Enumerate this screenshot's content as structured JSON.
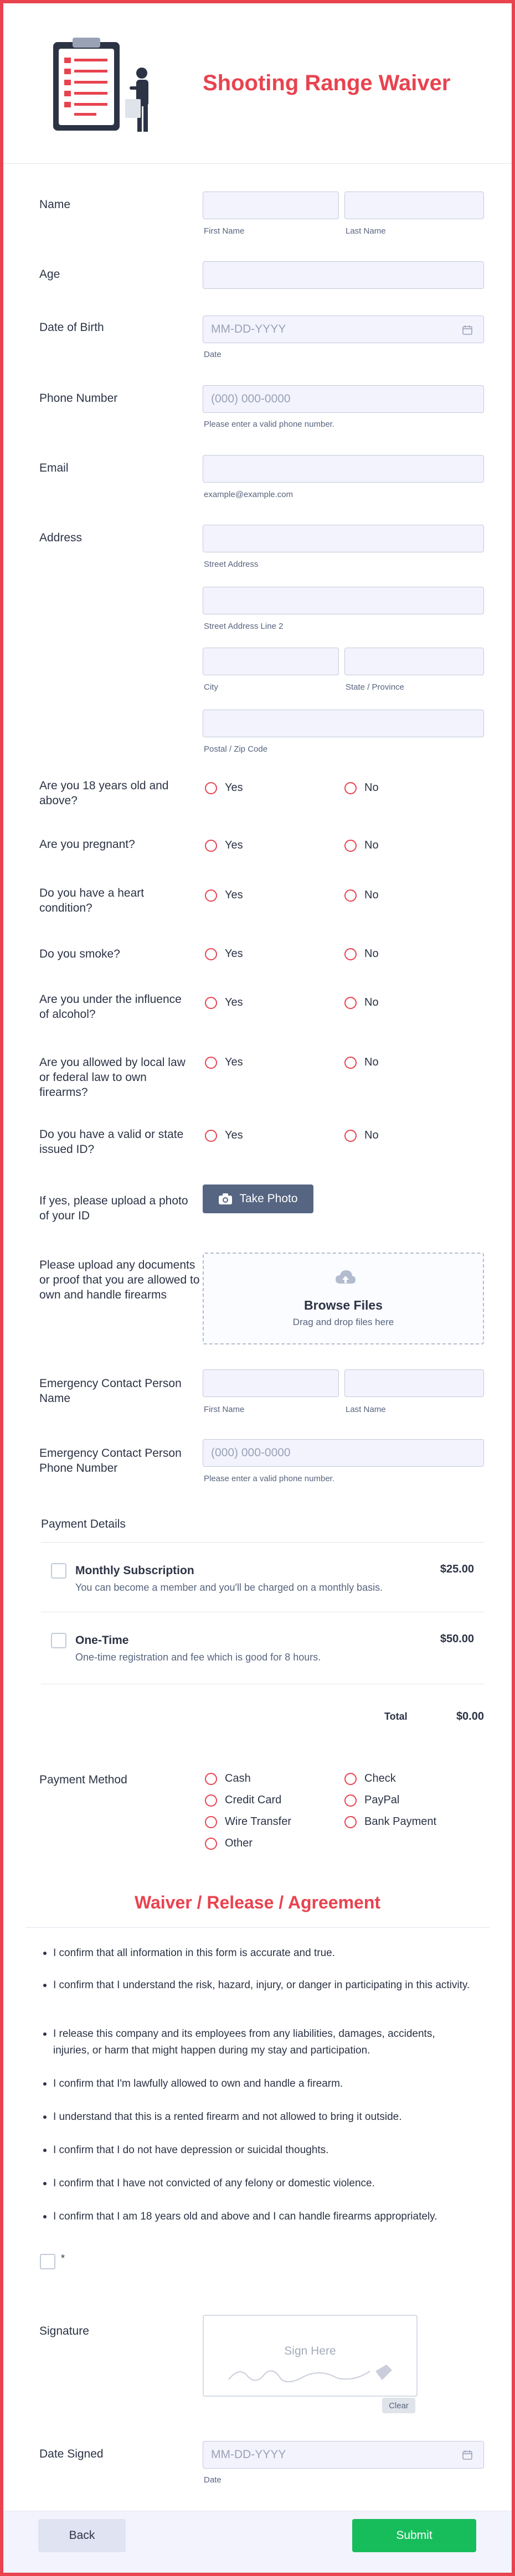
{
  "header": {
    "title": "Shooting Range Waiver"
  },
  "fields": {
    "name": {
      "label": "Name",
      "first_sub": "First Name",
      "last_sub": "Last Name",
      "first_value": "",
      "last_value": ""
    },
    "age": {
      "label": "Age",
      "value": ""
    },
    "dob": {
      "label": "Date of Birth",
      "placeholder": "MM-DD-YYYY",
      "sub": "Date"
    },
    "phone": {
      "label": "Phone Number",
      "placeholder": "(000) 000-0000",
      "sub": "Please enter a valid phone number."
    },
    "email": {
      "label": "Email",
      "sub": "example@example.com"
    },
    "address": {
      "label": "Address",
      "street_sub": "Street Address",
      "street2_sub": "Street Address Line 2",
      "city_sub": "City",
      "state_sub": "State / Province",
      "zip_sub": "Postal / Zip Code"
    }
  },
  "yes_no": {
    "yes": "Yes",
    "no": "No",
    "questions": [
      "Are you 18 years old and above?",
      "Are you pregnant?",
      "Do you have a heart condition?",
      "Do you smoke?",
      "Are you under the influence of alcohol?",
      "Are you allowed by local law or federal law to own firearms?",
      "Do you have a valid or state issued ID?"
    ]
  },
  "photo": {
    "label": "If yes, please upload a photo of your ID",
    "button": "Take Photo"
  },
  "upload": {
    "label": "Please upload any documents or proof that you are allowed to own and handle firearms",
    "title": "Browse Files",
    "hint": "Drag and drop files here"
  },
  "emergency": {
    "name_label": "Emergency Contact Person Name",
    "first_sub": "First Name",
    "last_sub": "Last Name",
    "phone_label": "Emergency Contact Person Phone Number",
    "phone_placeholder": "(000) 000-0000",
    "phone_sub": "Please enter a valid phone number."
  },
  "payment": {
    "label": "Payment Details",
    "products": [
      {
        "name": "Monthly Subscription",
        "desc": "You can become a member and you'll be charged on a monthly basis.",
        "price": "$25.00"
      },
      {
        "name": "One-Time",
        "desc": "One-time registration and fee which is good for 8 hours.",
        "price": "$50.00"
      }
    ],
    "total_label": "Total",
    "total_value": "$0.00"
  },
  "payment_method": {
    "label": "Payment Method",
    "options": [
      "Cash",
      "Check",
      "Credit Card",
      "PayPal",
      "Wire Transfer",
      "Bank Payment",
      "Other"
    ]
  },
  "agreement": {
    "title": "Waiver / Release / Agreement",
    "items": [
      "I confirm that all information in this form is accurate and true.",
      "I confirm that I understand the risk, hazard, injury, or danger in participating in this activity.",
      "I release this company and its employees from any liabilities, damages, accidents, injuries, or harm that might happen during my stay and participation.",
      "I confirm that I'm lawfully allowed to own and handle a firearm.",
      "I understand that this is a rented firearm and not allowed to bring it outside.",
      "I confirm that I do not have depression or suicidal thoughts.",
      "I confirm that I have not convicted of any felony or domestic violence.",
      "I confirm that I am 18 years old and above and I can handle firearms appropriately."
    ],
    "required_mark": "*"
  },
  "signature": {
    "label": "Signature",
    "placeholder": "Sign Here",
    "clear": "Clear"
  },
  "date_signed": {
    "label": "Date Signed",
    "placeholder": "MM-DD-YYYY",
    "sub": "Date"
  },
  "footer": {
    "back": "Back",
    "submit": "Submit"
  },
  "colors": {
    "accent": "#e8434f",
    "submit": "#18bd5b",
    "input_bg": "#f3f3fe",
    "button_dark": "#566582"
  }
}
